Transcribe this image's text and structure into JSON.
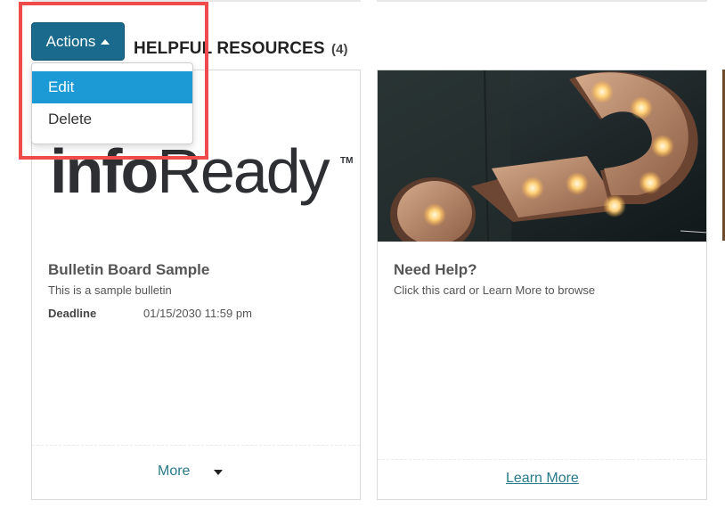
{
  "section": {
    "title": "HELPFUL RESOURCES",
    "count": "(4)"
  },
  "actions": {
    "label": "Actions",
    "menu": [
      {
        "label": "Edit",
        "active": true
      },
      {
        "label": "Delete",
        "active": false
      }
    ]
  },
  "cards": [
    {
      "logo": {
        "light": "info",
        "rest": "Ready",
        "tm": "TM"
      },
      "title": "Bulletin Board Sample",
      "description": "This is a sample bulletin",
      "deadline_label": "Deadline",
      "deadline_value": "01/15/2030 11:59 pm",
      "footer_link": "More"
    },
    {
      "title": "Need Help?",
      "description": "Click this card or Learn More to browse",
      "footer_link": "Learn More"
    }
  ],
  "colors": {
    "accent": "#1a6a8d",
    "menu_active": "#1b9ad6",
    "link": "#2a7a8a",
    "highlight": "#ef4b4b"
  },
  "icons": {
    "actions_caret": "caret-up-icon",
    "more_caret": "caret-down-icon"
  }
}
